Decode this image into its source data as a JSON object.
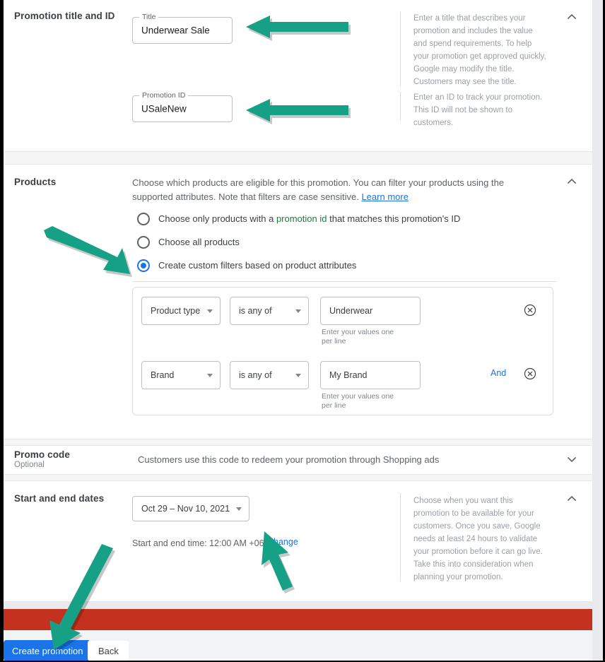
{
  "sections": {
    "title_id": {
      "heading": "Promotion title and ID",
      "title_field": {
        "label": "Title",
        "value": "Underwear Sale"
      },
      "promo_id_field": {
        "label": "Promotion ID",
        "value": "USaleNew"
      },
      "help_title": "Enter a title that describes your promotion and includes the value and spend requirements. To help your promotion get approved quickly, Google may modify the title. Customers may see the title.",
      "help_id": "Enter an ID to track your promotion. This ID will not be shown to customers.",
      "collapse_icon": "chevron-up-icon"
    },
    "products": {
      "heading": "Products",
      "description_part1": "Choose which products are eligible for this promotion. You can filter your products using the supported attributes. Note that filters are case sensitive. ",
      "learn_more": "Learn more",
      "options": [
        {
          "label_pre": "Choose only products with a ",
          "label_token": "promotion id",
          "label_post": " that matches this promotion's ID",
          "selected": false
        },
        {
          "label_pre": "Choose all products",
          "label_token": "",
          "label_post": "",
          "selected": false
        },
        {
          "label_pre": "Create custom filters based on product attributes",
          "label_token": "",
          "label_post": "",
          "selected": true
        }
      ],
      "filters": [
        {
          "attribute": "Product type",
          "operator": "is any of",
          "value": "Underwear",
          "hint": "Enter your values one per line",
          "conjunction": "",
          "remove_icon": "remove-circle-x-icon"
        },
        {
          "attribute": "Brand",
          "operator": "is any of",
          "value": "My Brand",
          "hint": "Enter your values one per line",
          "conjunction": "And",
          "remove_icon": "remove-circle-x-icon"
        }
      ],
      "collapse_icon": "chevron-up-icon"
    },
    "promo_code": {
      "heading": "Promo code",
      "subheading": "Optional",
      "description": "Customers use this code to redeem your promotion through Shopping ads",
      "expand_icon": "chevron-down-icon"
    },
    "dates": {
      "heading": "Start and end dates",
      "range_value": "Oct 29 – Nov 10, 2021",
      "time_text": "Start and end time: 12:00 AM +06",
      "change_link": "Change",
      "help": "Choose when you want this promotion to be available for your customers. Once you save, Google needs at least 24 hours to validate your promotion before it can go live. Take this into consideration when planning your promotion.",
      "collapse_icon": "chevron-up-icon"
    }
  },
  "footer": {
    "primary_label": "Create promotion",
    "secondary_label": "Back"
  },
  "colors": {
    "accent_blue": "#1a73e8",
    "green_token": "#188038",
    "error_bar_red": "#c5311f",
    "annotation_teal": "#16a085"
  },
  "annotations": {
    "arrow_title": "left-arrow-annotation",
    "arrow_promo_id": "left-arrow-annotation",
    "arrow_radio": "diagonal-arrow-annotation",
    "arrow_change": "up-arrow-annotation",
    "arrow_create": "down-left-arrow-annotation"
  }
}
